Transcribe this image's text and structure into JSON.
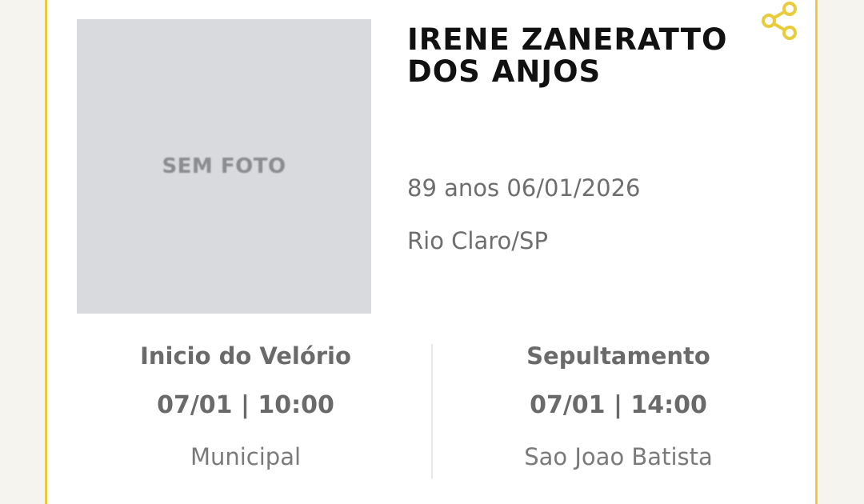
{
  "accent_color": "#e8cc3e",
  "photo": {
    "placeholder_label": "SEM FOTO"
  },
  "share": {
    "icon": "share-icon"
  },
  "deceased": {
    "name": "IRENE ZANERATTO DOS ANJOS",
    "age_date": "89 anos 06/01/2026",
    "location": "Rio Claro/SP"
  },
  "wake": {
    "title": "Inicio do Velório",
    "datetime": "07/01 | 10:00",
    "place": "Municipal"
  },
  "burial": {
    "title": "Sepultamento",
    "datetime": "07/01 | 14:00",
    "place": "Sao Joao Batista"
  }
}
